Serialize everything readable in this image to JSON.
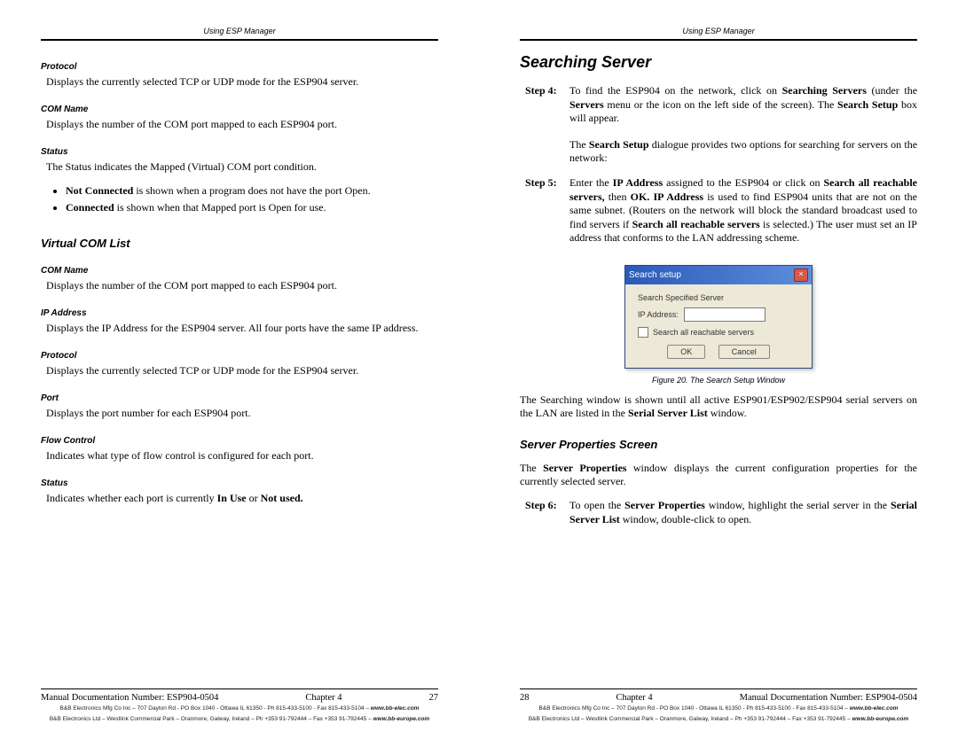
{
  "header": "Using ESP Manager",
  "left": {
    "terms": [
      {
        "label": "Protocol",
        "text": "Displays the currently selected TCP or UDP mode for the ESP904 server."
      },
      {
        "label": "COM Name",
        "text": "Displays the number of the COM port mapped to each ESP904 port."
      },
      {
        "label": "Status",
        "text": "The Status indicates the Mapped (Virtual) COM port condition."
      }
    ],
    "bullets_html": [
      "<b>Not Connected</b> is shown when a program does not have the port Open.",
      "<b>Connected</b> is shown when that Mapped port is Open for use."
    ],
    "section_title": "Virtual COM List",
    "vlist": [
      {
        "label": "COM Name",
        "text": "Displays the number of the COM port mapped to each ESP904 port."
      },
      {
        "label": "IP Address",
        "text": "Displays the IP Address for the ESP904 server. All four ports have the same IP address."
      },
      {
        "label": "Protocol",
        "text": "Displays the currently selected TCP or UDP mode for the ESP904 server."
      },
      {
        "label": "Port",
        "text": "Displays the port number for each ESP904 port."
      },
      {
        "label": "Flow Control",
        "text": "Indicates what type of flow control is configured for each port."
      },
      {
        "label": "Status",
        "text_html": "Indicates whether each port is currently <b>In Use</b> or <b>Not used.</b>"
      }
    ],
    "footer": {
      "doc": "Manual Documentation Number: ESP904-0504",
      "chapter": "Chapter 4",
      "page": "27"
    }
  },
  "right": {
    "title": "Searching Server",
    "step4_label": "Step 4:",
    "step4_html": "To find the ESP904 on the network, click on <b>Searching Servers</b> (under the <b>Servers</b> menu or the icon on the left side of the screen). The <b>Search Setup</b> box will appear.",
    "para1_html": "The <b>Search Setup</b> dialogue provides two options for searching for servers on the network:",
    "step5_label": "Step 5:",
    "step5_html": "Enter the <b>IP Address</b> assigned to the ESP904 or click on <b>Search all reachable servers,</b> then <b>OK. IP Address</b> is used to find ESP904 units that are not on the same subnet. (Routers on the network will block the standard broadcast used to find servers if <b>Search all reachable servers</b> is selected.) The user must set an IP address that conforms to the LAN addressing scheme.",
    "dialog": {
      "title": "Search setup",
      "field1": "Search Specified Server",
      "field2": "IP Address:",
      "checkbox": "Search all reachable servers",
      "ok": "OK",
      "cancel": "Cancel"
    },
    "fig_caption": "Figure 20. The Search Setup Window",
    "para2_html": "The Searching window is shown until all active ESP901/ESP902/ESP904 serial servers on the LAN are listed in the <b>Serial Server List</b> window.",
    "section_title": "Server Properties Screen",
    "para3_html": "The <b>Server Properties</b> window displays the current configuration properties for the currently selected server.",
    "step6_label": "Step 6:",
    "step6_html": "To open the <b>Server Properties</b> window, highlight the serial server in the <b>Serial Server List</b> window, double-click to open.",
    "footer": {
      "page": "28",
      "chapter": "Chapter 4",
      "doc": "Manual Documentation Number: ESP904-0504"
    }
  },
  "fine1": "B&B Electronics Mfg Co Inc – 707 Dayton Rd - PO Box 1040 - Ottawa IL 61350 - Ph 815-433-5100 - Fax 815-433-5104 – <b><i>www.bb-elec.com</i></b>",
  "fine2": "B&B Electronics Ltd – Westlink Commercial Park – Oranmore, Galway, Ireland – Ph +353 91-792444 – Fax +353 91-792445 – <b><i>www.bb-europe.com</i></b>"
}
